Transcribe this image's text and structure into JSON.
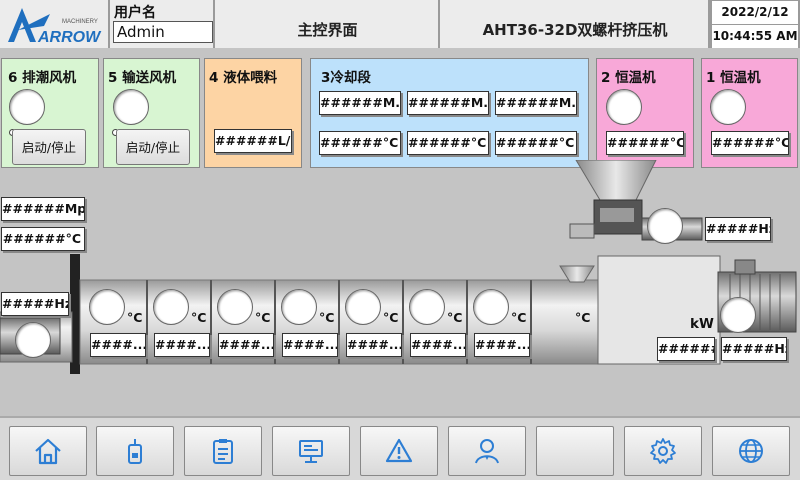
{
  "header": {
    "brand_small": "MACHINERY",
    "brand": "ARROW",
    "user_label": "用户名",
    "user_value": "Admin",
    "screen_title": "主控界面",
    "machine": "AHT36-32D双螺杆挤压机",
    "date": "2022/2/12",
    "time": "10:44:55 AM"
  },
  "panels": {
    "exhaust_fan": {
      "title": "6 排潮风机",
      "button": "启动/停止"
    },
    "conveyor_fan": {
      "title": "5 输送风机",
      "button": "启动/停止"
    },
    "liquid_feed": {
      "title": "4 液体喂料",
      "value": "######L/h"
    },
    "cooling": {
      "title": "3冷却段",
      "pressures": [
        "######M...",
        "######M...",
        "######M..."
      ],
      "temps": [
        "######°C",
        "######°C",
        "######°C"
      ]
    },
    "thermostat2": {
      "title": "2 恒温机",
      "value": "######°C"
    },
    "thermostat1": {
      "title": "1 恒温机",
      "value": "######°C"
    }
  },
  "machine": {
    "die_pressure": "######Mpa",
    "die_temp": "######°C",
    "cutter_hz": "#####Hz",
    "feeder_hz": "#####Hz",
    "zone_unit": "°C",
    "zone_values": [
      "####...",
      "####...",
      "####...",
      "####...",
      "####...",
      "####...",
      "####..."
    ],
    "power_unit": "kW",
    "power_value": "######",
    "motor_hz": "#####Hz"
  },
  "nav": [
    "home-icon",
    "device-icon",
    "clipboard-icon",
    "monitor-icon",
    "alarm-icon",
    "user-icon",
    "blank",
    "settings-icon",
    "globe-icon"
  ],
  "colors": {
    "green": "#d8f5d2",
    "orange": "#fdd4a4",
    "blue": "#bde1fb",
    "pink": "#f8a8d8",
    "icon": "#2d7ed4"
  }
}
